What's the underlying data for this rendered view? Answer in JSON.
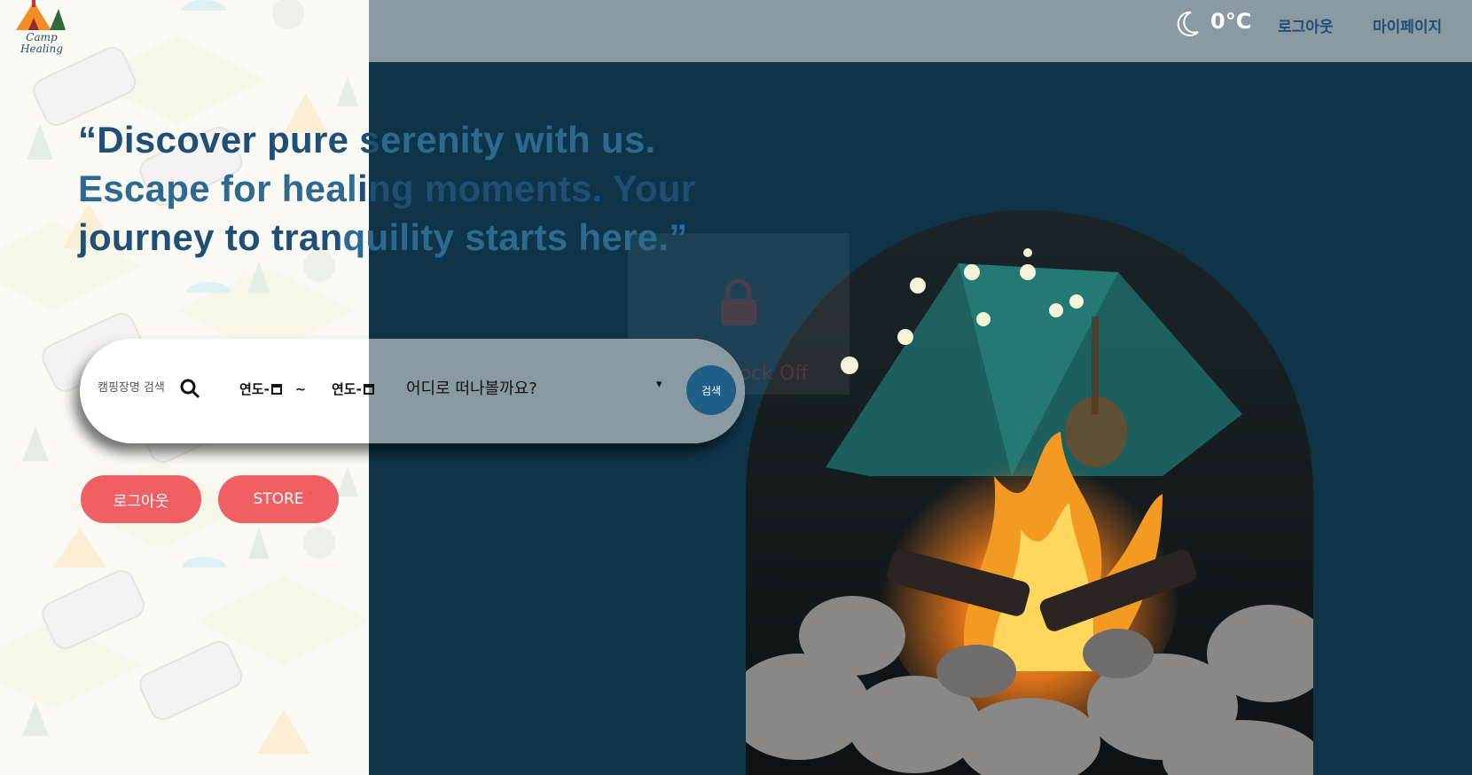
{
  "brand": {
    "logo_line1": "Camp",
    "logo_line2": "Healing"
  },
  "header": {
    "weather_icon": "moon-icon",
    "temperature": "0°C",
    "logout_label": "로그아웃",
    "mypage_label": "마이페이지"
  },
  "hero": {
    "quote_part1": "“Discover pure s",
    "quote_part2": "erenity with us. Escape for heal",
    "quote_part3": "ing moments. Your journey to tran",
    "quote_part4": "quility starts here.”"
  },
  "scroll_lock": {
    "label": "Scroll Lock Off",
    "icon": "lock-icon"
  },
  "search": {
    "placeholder": "캠핑장명 검색",
    "start_date": "연도-",
    "separator": "~",
    "end_date": "연도-",
    "destination_placeholder": "어디로 떠나볼까요?",
    "submit_label": "검색"
  },
  "buttons": {
    "logout": "로그아웃",
    "store": "STORE"
  },
  "colors": {
    "page_bg": "#0f3347",
    "topbar": "#8a9aa2",
    "headline": "#1f4f74",
    "accent_button": "#ef5f63",
    "search_button": "#1f5e86"
  }
}
